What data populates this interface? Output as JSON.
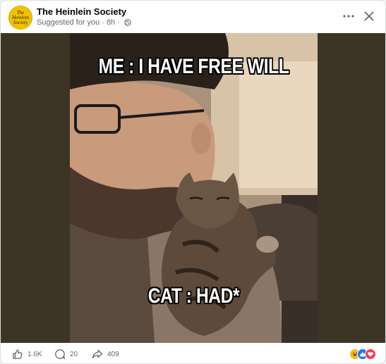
{
  "post": {
    "page_name": "The Heinlein Society",
    "suggestion_label": "Suggested for you",
    "separator": "·",
    "timestamp": "8h",
    "privacy_icon": "globe-icon",
    "avatar_lines": [
      "The",
      "Heinlein",
      "Society"
    ]
  },
  "header": {
    "more_icon": "more-horizontal-icon",
    "close_icon": "close-icon"
  },
  "meme": {
    "top_text": "ME : I HAVE FREE WILL",
    "bottom_text": "CAT : HAD*"
  },
  "footer": {
    "like_count": "1.6K",
    "comment_count": "20",
    "share_count": "409",
    "reactions": [
      "haha-icon",
      "like-icon",
      "love-icon"
    ]
  },
  "colors": {
    "brand_blue": "#1877f2",
    "avatar_yellow": "#f2c200",
    "muted_text": "#65676b",
    "media_background": "#3c3526"
  }
}
